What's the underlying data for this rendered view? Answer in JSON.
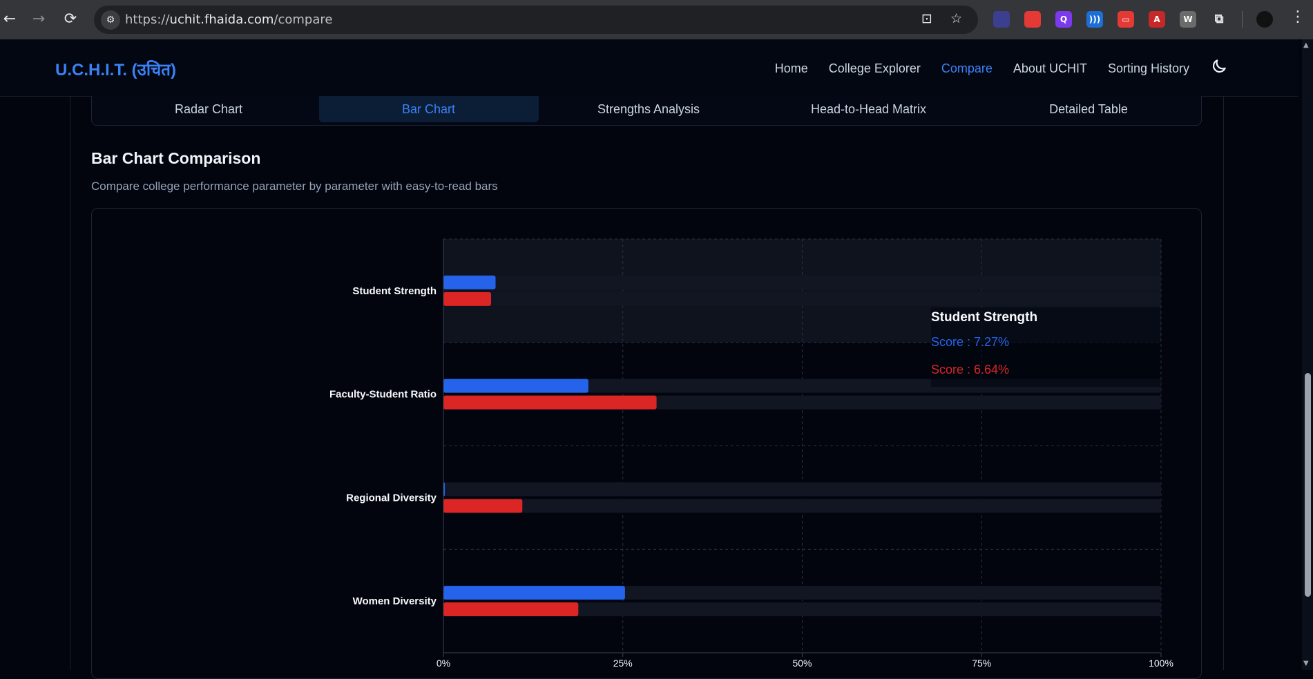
{
  "browser": {
    "url_scheme": "https://",
    "url_host": "uchit.fhaida.com",
    "url_path": "/compare",
    "extensions": [
      {
        "name": "ext-1",
        "letter": "",
        "color": "#3c3f8f"
      },
      {
        "name": "ext-2",
        "letter": "",
        "color": "#e53935"
      },
      {
        "name": "ext-3",
        "letter": "Q",
        "color": "#7c3aed"
      },
      {
        "name": "ext-4",
        "letter": ")))",
        "color": "#1d6fd6"
      },
      {
        "name": "ext-5",
        "letter": "▭",
        "color": "#e53935"
      },
      {
        "name": "ext-6",
        "letter": "A",
        "color": "#c62828"
      },
      {
        "name": "ext-7",
        "letter": "W",
        "color": "#6b6b6b"
      }
    ]
  },
  "app": {
    "brand": "U.C.H.I.T. (उचित)",
    "nav": [
      "Home",
      "College Explorer",
      "Compare",
      "About UCHIT",
      "Sorting History"
    ],
    "active_nav": "Compare"
  },
  "tabs": [
    "Radar Chart",
    "Bar Chart",
    "Strengths Analysis",
    "Head-to-Head Matrix",
    "Detailed Table"
  ],
  "active_tab": "Bar Chart",
  "section": {
    "title": "Bar Chart Comparison",
    "subtitle": "Compare college performance parameter by parameter with easy-to-read bars"
  },
  "chart_data": {
    "type": "bar",
    "orientation": "horizontal",
    "categories": [
      "Student Strength",
      "Faculty-Student Ratio",
      "Regional Diversity",
      "Women Diversity"
    ],
    "series": [
      {
        "color": "#2563eb",
        "values": [
          7.27,
          20.2,
          0.2,
          25.3
        ]
      },
      {
        "color": "#dc2626",
        "values": [
          6.64,
          29.7,
          11.0,
          18.8
        ]
      }
    ],
    "xlim": [
      0,
      100
    ],
    "x_ticks": [
      "0%",
      "25%",
      "50%",
      "75%",
      "100%"
    ],
    "grid": true,
    "highlighted_category": "Student Strength"
  },
  "tooltip": {
    "title": "Student Strength",
    "lines": [
      {
        "text": "Score : 7.27%",
        "color": "#2563eb"
      },
      {
        "text": "Score : 6.64%",
        "color": "#dc2626"
      }
    ]
  }
}
